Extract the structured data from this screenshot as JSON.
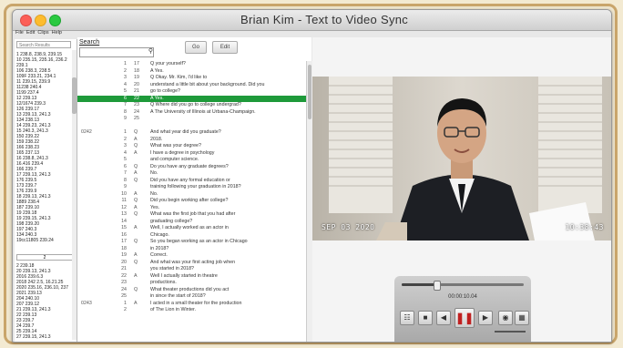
{
  "window": {
    "title": "Brian Kim - Text to Video Sync"
  },
  "menu": [
    "File",
    "Edit",
    "Clips",
    "Help"
  ],
  "left_pane": {
    "search_placeholder": "Search Results",
    "index_top": "1 238.8, 238.9, 239.15\n10 235.15, 235.16, 236.2\n239.1\n106 238.3, 238.5\n109F 233.21, 234.1\n11 239.15, 239.9\n11238 240.4\n1199 237.4\n12 239.13\n12/1674 239.3\n126 239.17\n13 239.13, 241.3\n134 238.13\n14 239.23, 241.3\n15 240.3, 241.3\n150 239.22\n159 238.22\n166 238.23\n165 237.13\n16 238.8, 241.3\n16.416 239.4\n166 239.7\n17 239.13, 241.3\n176 239.5\n173 239.7\n176 239.9\n18 239.13, 241.3\n1889 238.4\n187 239.10\n19 239.18\n19 239.15, 241.3\n198 239.20\n197 240.3\n134 240.3\n19cc11805 239.24",
    "index_separator": "2",
    "index_bottom": "2 239.18\n20 239.13, 241.3\n2016 239.6.3\n2018 242 2.5, 16.21.25\n2020 235.16, 236.10, 237\n2021 239.13\n204 240.10\n207 239.12\n21 239.13, 241.3\n22 239.13\n23 239.7\n24 239.7\n25 239.14\n27 239.15, 241.3"
  },
  "transcript": {
    "search_label": "Search",
    "buttons": {
      "go": "Go",
      "edit": "Edit"
    },
    "lines": [
      {
        "page": "",
        "line": "1",
        "speaker": "17",
        "text": "Q    your yourself?",
        "highlight": false
      },
      {
        "page": "",
        "line": "2",
        "speaker": "18",
        "text": "A    Yes.",
        "highlight": false
      },
      {
        "page": "",
        "line": "3",
        "speaker": "19",
        "text": "Q    Okay.  Mr. Kim, I'd like to",
        "highlight": false
      },
      {
        "page": "",
        "line": "4",
        "speaker": "20",
        "text": "understand a little bit about your background.  Did you",
        "highlight": false
      },
      {
        "page": "",
        "line": "5",
        "speaker": "21",
        "text": "go to college?",
        "highlight": false
      },
      {
        "page": "",
        "line": "6",
        "speaker": "22",
        "text": "A    Yes.",
        "highlight": true
      },
      {
        "page": "",
        "line": "7",
        "speaker": "23",
        "text": "Q    Where did you go to college undergrad?",
        "highlight": false
      },
      {
        "page": "",
        "line": "8",
        "speaker": "24",
        "text": "A    The University of Illinois at Urbana-Champaign.",
        "highlight": false
      },
      {
        "page": "",
        "line": "9",
        "speaker": "25",
        "text": "",
        "highlight": false
      },
      {
        "page": "",
        "line": "",
        "speaker": "",
        "text": "",
        "highlight": false
      },
      {
        "page": "0242",
        "line": "1",
        "speaker": "Q",
        "text": "And what year did you graduate?",
        "highlight": false
      },
      {
        "page": "",
        "line": "2",
        "speaker": "A",
        "text": "2018.",
        "highlight": false
      },
      {
        "page": "",
        "line": "3",
        "speaker": "Q",
        "text": "What was your degree?",
        "highlight": false
      },
      {
        "page": "",
        "line": "4",
        "speaker": "A",
        "text": "I have a degree in psychology",
        "highlight": false
      },
      {
        "page": "",
        "line": "5",
        "speaker": "",
        "text": "and computer science.",
        "highlight": false
      },
      {
        "page": "",
        "line": "6",
        "speaker": "Q",
        "text": "Do you have any graduate degrees?",
        "highlight": false
      },
      {
        "page": "",
        "line": "7",
        "speaker": "A",
        "text": "No.",
        "highlight": false
      },
      {
        "page": "",
        "line": "8",
        "speaker": "Q",
        "text": "Did you have any formal education or",
        "highlight": false
      },
      {
        "page": "",
        "line": "9",
        "speaker": "",
        "text": "training following your graduation in 2018?",
        "highlight": false
      },
      {
        "page": "",
        "line": "10",
        "speaker": "A",
        "text": "No.",
        "highlight": false
      },
      {
        "page": "",
        "line": "11",
        "speaker": "Q",
        "text": "Did you begin working after college?",
        "highlight": false
      },
      {
        "page": "",
        "line": "12",
        "speaker": "A",
        "text": "Yes.",
        "highlight": false
      },
      {
        "page": "",
        "line": "13",
        "speaker": "Q",
        "text": "What was the first job that you had after",
        "highlight": false
      },
      {
        "page": "",
        "line": "14",
        "speaker": "",
        "text": "graduating college?",
        "highlight": false
      },
      {
        "page": "",
        "line": "15",
        "speaker": "A",
        "text": "Well, I actually worked as an actor in",
        "highlight": false
      },
      {
        "page": "",
        "line": "16",
        "speaker": "",
        "text": "Chicago.",
        "highlight": false
      },
      {
        "page": "",
        "line": "17",
        "speaker": "Q",
        "text": "So you began working as an actor in Chicago",
        "highlight": false
      },
      {
        "page": "",
        "line": "18",
        "speaker": "",
        "text": "in 2018?",
        "highlight": false
      },
      {
        "page": "",
        "line": "19",
        "speaker": "A",
        "text": "Correct.",
        "highlight": false
      },
      {
        "page": "",
        "line": "20",
        "speaker": "Q",
        "text": "And what was your first acting job when",
        "highlight": false
      },
      {
        "page": "",
        "line": "21",
        "speaker": "",
        "text": "you started in 2018?",
        "highlight": false
      },
      {
        "page": "",
        "line": "22",
        "speaker": "A",
        "text": "Well I actually started in theatre",
        "highlight": false
      },
      {
        "page": "",
        "line": "23",
        "speaker": "",
        "text": "productions.",
        "highlight": false
      },
      {
        "page": "",
        "line": "24",
        "speaker": "Q",
        "text": "What theater productions did you act",
        "highlight": false
      },
      {
        "page": "",
        "line": "25",
        "speaker": "",
        "text": "in since the start of 2018?",
        "highlight": false
      },
      {
        "page": "0243",
        "line": "1",
        "speaker": "A",
        "text": "I acted in a small theater for the production",
        "highlight": false
      },
      {
        "page": "",
        "line": "2",
        "speaker": "",
        "text": "of The Lion in Winter.",
        "highlight": false
      }
    ]
  },
  "video": {
    "date_stamp": "SEP 03 2020",
    "time_stamp": "10:38:43",
    "playback_time": "00:00:10.04",
    "progress_fraction": 0.28,
    "icons": [
      "clip-icon",
      "stop-icon",
      "prev-icon",
      "pause-icon",
      "next-icon",
      "camera-icon",
      "grid-icon"
    ]
  }
}
